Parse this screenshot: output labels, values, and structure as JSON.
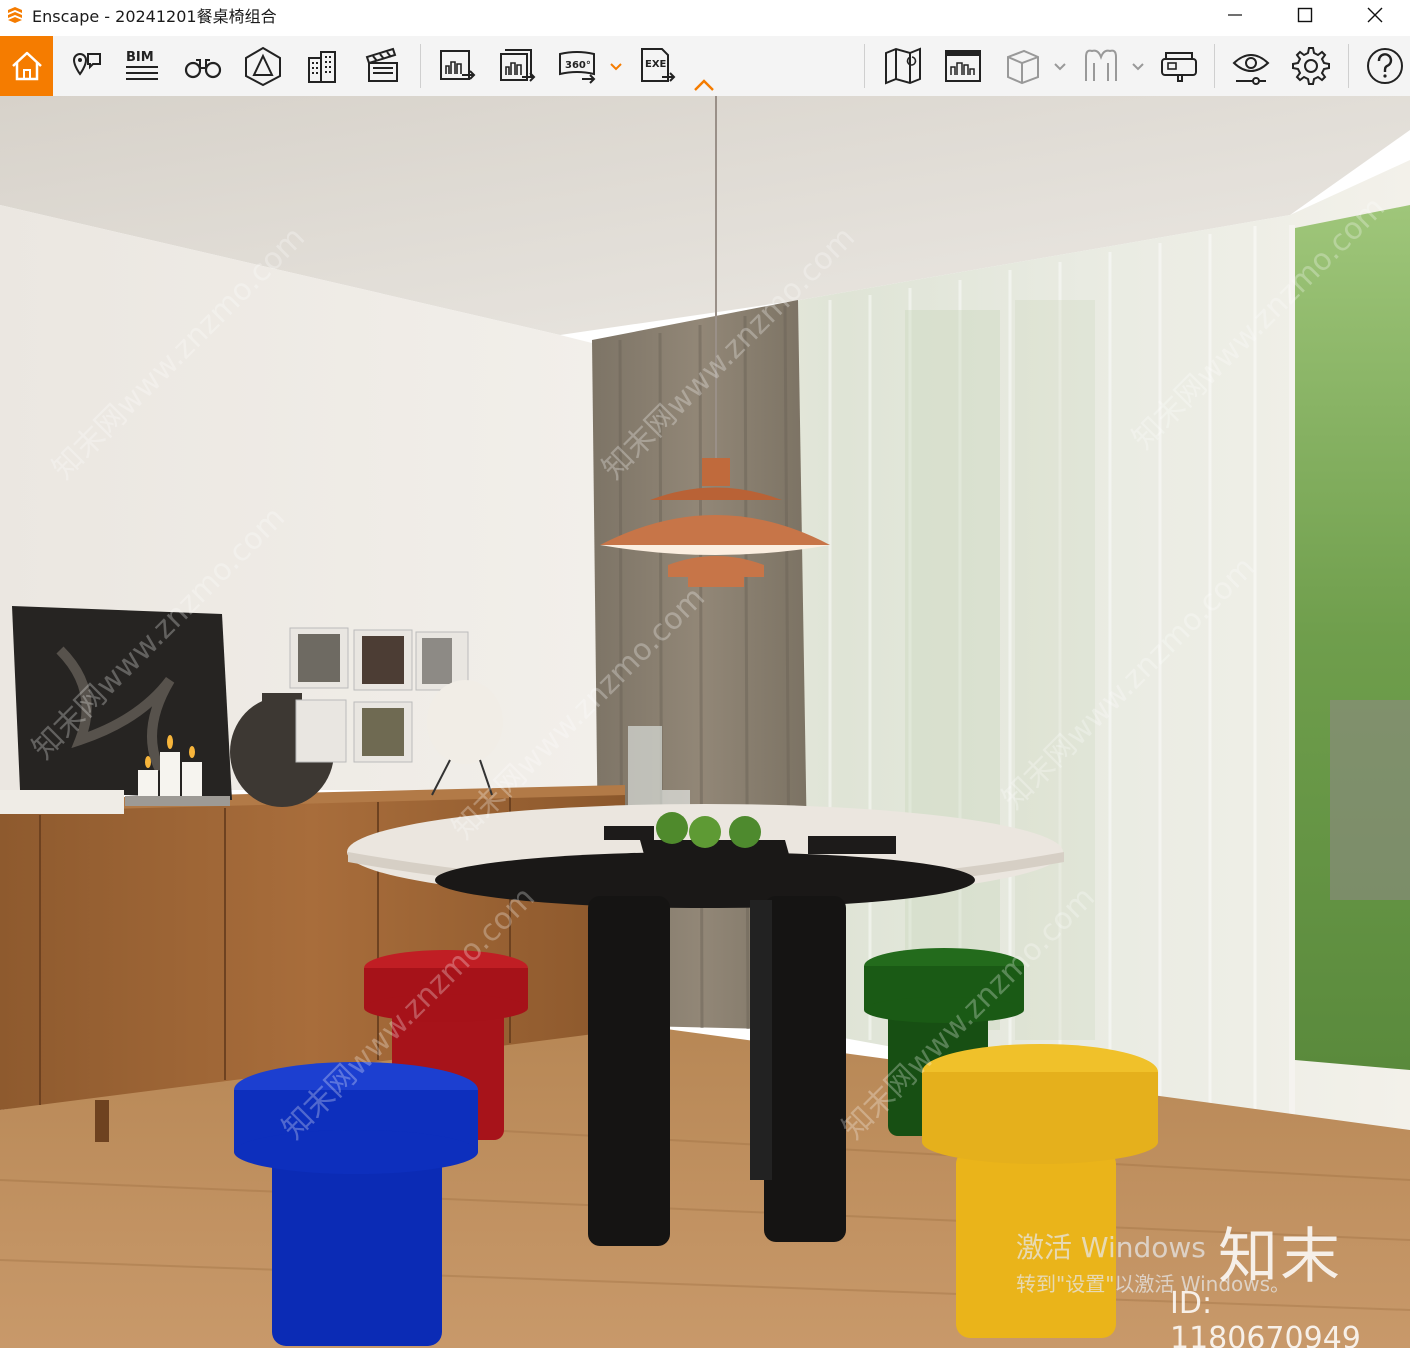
{
  "window": {
    "title": "Enscape - 20241201餐桌椅组合",
    "controls": [
      "minimize",
      "maximize",
      "close"
    ]
  },
  "toolbar": {
    "left_icons": [
      "home-icon",
      "location-pin-icon",
      "bim-icon",
      "binoculars-icon",
      "perspective-icon",
      "buildings-icon",
      "clapperboard-icon",
      "export-image-icon",
      "batch-export-icon",
      "export-360-icon",
      "export-exe-icon"
    ],
    "bim_label": "BIM",
    "pano_label": "360°",
    "exe_label": "EXE",
    "right_icons": [
      "map-icon",
      "asset-library-icon",
      "cube-icon",
      "ghost-icon",
      "vr-headset-icon",
      "visual-settings-icon",
      "settings-icon",
      "help-icon"
    ],
    "accent_color": "#f57c00"
  },
  "viewport": {
    "activate_line1": "激活 Windows",
    "activate_line2": "转到\"设置\"以激活 Windows。",
    "brand_logo": "知末",
    "brand_id": "ID: 1180670949",
    "watermark": "知末网www.znzmo.com"
  }
}
